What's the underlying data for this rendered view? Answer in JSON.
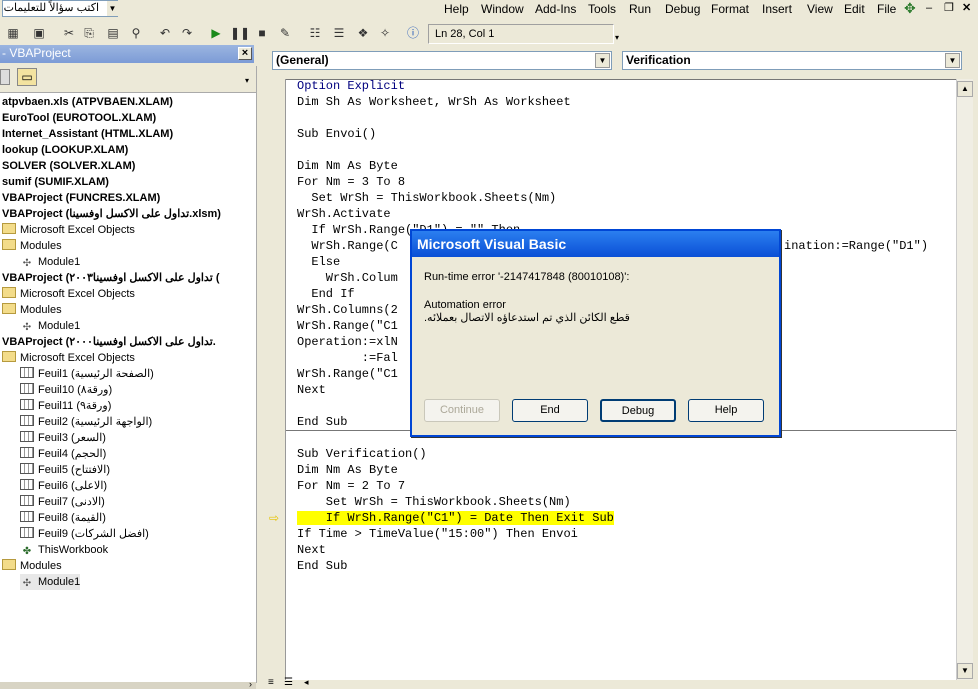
{
  "menubar": {
    "ask_placeholder": "اكتب سؤالاً للتعليمات",
    "items": [
      "Help",
      "Window",
      "Add-Ins",
      "Tools",
      "Run",
      "Debug",
      "Format",
      "Insert",
      "View",
      "Edit",
      "File"
    ]
  },
  "toolbar": {
    "position": "Ln 28, Col 1"
  },
  "project_explorer": {
    "title": "- VBAProject",
    "nodes": [
      "atpvbaen.xls (ATPVBAEN.XLAM)",
      "EuroTool (EUROTOOL.XLAM)",
      "Internet_Assistant (HTML.XLAM)",
      "lookup (LOOKUP.XLAM)",
      "SOLVER (SOLVER.XLAM)",
      "sumif (SUMIF.XLAM)",
      "VBAProject (FUNCRES.XLAM)",
      "VBAProject (تداول على الاكسل اوفسينا.xlsm)",
      "Microsoft Excel Objects",
      "Modules",
      "Module1",
      "VBAProject (تداول على الاكسل اوفسينا٢٠٠٣ (",
      "Microsoft Excel Objects",
      "Modules",
      "Module1",
      "VBAProject (تداول على الاكسل اوفسينا٢٠٠٠.",
      "Microsoft Excel Objects",
      "Feuil1 (الصفحة الرئيسية)",
      "Feuil10 (ورقة٨)",
      "Feuil11 (ورقة٩)",
      "Feuil2 (الواجهة الرئيسية)",
      "Feuil3 (السعر)",
      "Feuil4 (الحجم)",
      "Feuil5 (الافتتاح)",
      "Feuil6 (الاعلى)",
      "Feuil7 (الادنى)",
      "Feuil8 (القيمة)",
      "Feuil9 (افضل الشركات)",
      "ThisWorkbook",
      "Modules",
      "Module1"
    ]
  },
  "code_window": {
    "object_combo": "(General)",
    "proc_combo": "Verification",
    "lines": [
      "Option Explicit",
      "Dim Sh As Worksheet, WrSh As Worksheet",
      "",
      "Sub Envoi()",
      "",
      "Dim Nm As Byte",
      "For Nm = 3 To 8",
      "  Set WrSh = ThisWorkbook.Sheets(Nm)",
      "WrSh.Activate",
      "  If WrSh.Range(\"D1\") = \"\" Then",
      "  WrSh.Range(C",
      "  Else",
      "    WrSh.Colum",
      "  End If",
      "WrSh.Columns(2",
      "WrSh.Range(\"C1",
      "Operation:=xlN",
      "         :=Fal",
      "WrSh.Range(\"C1",
      "Next",
      "",
      "End Sub",
      "",
      "Sub Verification()",
      "Dim Nm As Byte",
      "For Nm = 2 To 7",
      "    Set WrSh = ThisWorkbook.Sheets(Nm)",
      "    If WrSh.Range(\"C1\") = Date Then Exit Sub",
      "If Time > TimeValue(\"15:00\") Then Envoi",
      "Next",
      "End Sub"
    ],
    "obscured_tail": "ination:=Range(\"D1\")"
  },
  "dialog": {
    "title": "Microsoft Visual Basic",
    "error_line": "Run-time error '-2147417848 (80010108)':",
    "message_1": "Automation error",
    "message_2": "قطع الكائن الذي تم استدعاؤه الاتصال بعملائه.",
    "buttons": {
      "continue": "Continue",
      "end": "End",
      "debug": "Debug",
      "help": "Help"
    }
  }
}
